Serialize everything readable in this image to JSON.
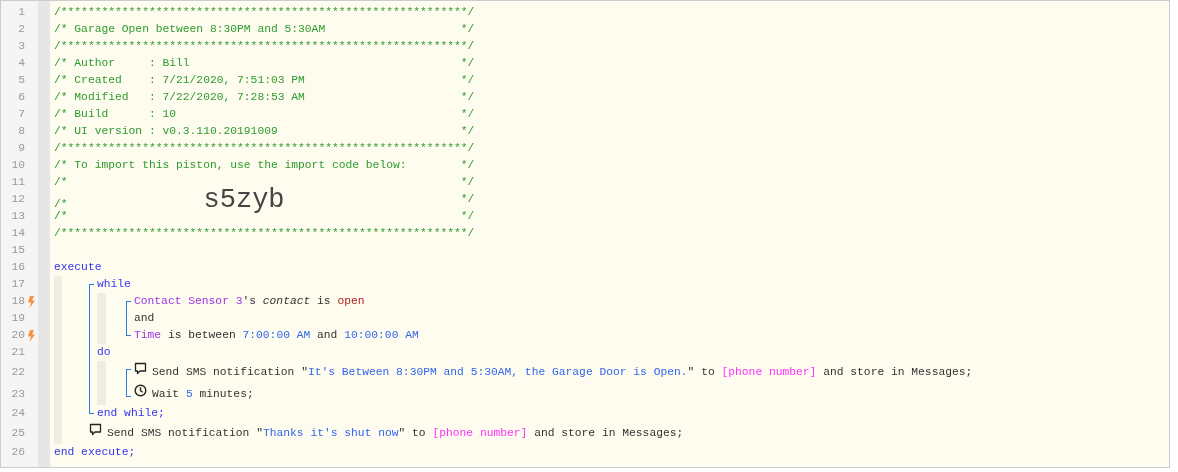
{
  "header": [
    {
      "number": "1",
      "tokens": [
        {
          "kind": "comment",
          "text": "/************************************************************/"
        }
      ]
    },
    {
      "number": "2",
      "tokens": [
        {
          "kind": "comment",
          "text": "/* Garage Open between 8:30PM and 5:30AM"
        }
      ],
      "close": "*/"
    },
    {
      "number": "3",
      "tokens": [
        {
          "kind": "comment",
          "text": "/************************************************************/"
        }
      ]
    },
    {
      "number": "4",
      "tokens": [
        {
          "kind": "comment",
          "text": "/* Author     : Bill"
        }
      ],
      "close": "*/"
    },
    {
      "number": "5",
      "tokens": [
        {
          "kind": "comment",
          "text": "/* Created    : 7/21/2020, 7:51:03 PM"
        }
      ],
      "close": "*/"
    },
    {
      "number": "6",
      "tokens": [
        {
          "kind": "comment",
          "text": "/* Modified   : 7/22/2020, 7:28:53 AM"
        }
      ],
      "close": "*/"
    },
    {
      "number": "7",
      "tokens": [
        {
          "kind": "comment",
          "text": "/* Build      : 10"
        }
      ],
      "close": "*/"
    },
    {
      "number": "8",
      "tokens": [
        {
          "kind": "comment",
          "text": "/* UI version : v0.3.110.20191009"
        }
      ],
      "close": "*/"
    },
    {
      "number": "9",
      "tokens": [
        {
          "kind": "comment",
          "text": "/************************************************************/"
        }
      ]
    },
    {
      "number": "10",
      "tokens": [
        {
          "kind": "comment",
          "text": "/* To import this piston, use the import code below:"
        }
      ],
      "close": "*/"
    },
    {
      "number": "11",
      "tokens": [
        {
          "kind": "comment",
          "text": "/*"
        }
      ],
      "close": "*/"
    },
    {
      "number": "12",
      "tokens": [
        {
          "kind": "comment",
          "text": "/*"
        },
        {
          "kind": "import_code",
          "text": "s5zyb"
        }
      ],
      "close": "*/"
    },
    {
      "number": "13",
      "tokens": [
        {
          "kind": "comment",
          "text": "/*"
        }
      ],
      "close": "*/"
    },
    {
      "number": "14",
      "tokens": [
        {
          "kind": "comment",
          "text": "/************************************************************/"
        }
      ]
    },
    {
      "number": "15"
    }
  ],
  "program": {
    "number": "16",
    "tokens": [
      {
        "kind": "keyword",
        "text": "execute"
      }
    ],
    "body": {
      "bracket": false,
      "items": [
        {
          "bracket": true,
          "sections": [
            {
              "number": "17",
              "tokens": [
                {
                  "kind": "keyword",
                  "text": "while"
                }
              ],
              "body": {
                "bracket": true,
                "items": [
                  {
                    "number": "18",
                    "trigger": true,
                    "tokens": [
                      {
                        "kind": "device",
                        "text": "Contact Sensor 3"
                      },
                      {
                        "kind": "plain",
                        "text": "'s "
                      },
                      {
                        "kind": "attribute",
                        "text": "contact"
                      },
                      {
                        "kind": "plain",
                        "text": " is "
                      },
                      {
                        "kind": "value",
                        "text": "open"
                      }
                    ]
                  },
                  {
                    "number": "19",
                    "trigger": false,
                    "tokens": [
                      {
                        "kind": "plain",
                        "text": "and"
                      }
                    ]
                  },
                  {
                    "number": "20",
                    "trigger": true,
                    "tokens": [
                      {
                        "kind": "device",
                        "text": "Time"
                      },
                      {
                        "kind": "plain",
                        "text": " is between "
                      },
                      {
                        "kind": "literal",
                        "text": "7:00:00 AM"
                      },
                      {
                        "kind": "plain",
                        "text": " and "
                      },
                      {
                        "kind": "literal",
                        "text": "10:00:00 AM"
                      }
                    ]
                  }
                ]
              }
            },
            {
              "number": "21",
              "tokens": [
                {
                  "kind": "keyword",
                  "text": "do"
                }
              ],
              "body": {
                "bracket": true,
                "items": [
                  {
                    "number": "22",
                    "kind": "sms",
                    "tokens": [
                      {
                        "kind": "plain",
                        "text": "Send SMS notification \""
                      },
                      {
                        "kind": "literal",
                        "text": "It's Between 8:30PM and 5:30AM, the Garage Door is Open."
                      },
                      {
                        "kind": "plain",
                        "text": "\" to "
                      },
                      {
                        "kind": "variable",
                        "text": "[phone number]"
                      },
                      {
                        "kind": "plain",
                        "text": " and store in Messages;"
                      }
                    ]
                  },
                  {
                    "number": "23",
                    "kind": "wait",
                    "tokens": [
                      {
                        "kind": "plain",
                        "text": "Wait "
                      },
                      {
                        "kind": "literal",
                        "text": "5"
                      },
                      {
                        "kind": "plain",
                        "text": " minutes;"
                      }
                    ]
                  }
                ]
              }
            }
          ],
          "end": {
            "number": "24",
            "tokens": [
              {
                "kind": "keyword",
                "text": "end while;"
              }
            ]
          }
        },
        {
          "number": "25",
          "kind": "sms",
          "tokens": [
            {
              "kind": "plain",
              "text": "Send SMS notification \""
            },
            {
              "kind": "literal",
              "text": "Thanks it's shut now"
            },
            {
              "kind": "plain",
              "text": "\" to "
            },
            {
              "kind": "variable",
              "text": "[phone number]"
            },
            {
              "kind": "plain",
              "text": " and store in Messages;"
            }
          ]
        }
      ]
    },
    "end": {
      "number": "26",
      "tokens": [
        {
          "kind": "keyword",
          "text": "end execute;"
        }
      ]
    }
  }
}
